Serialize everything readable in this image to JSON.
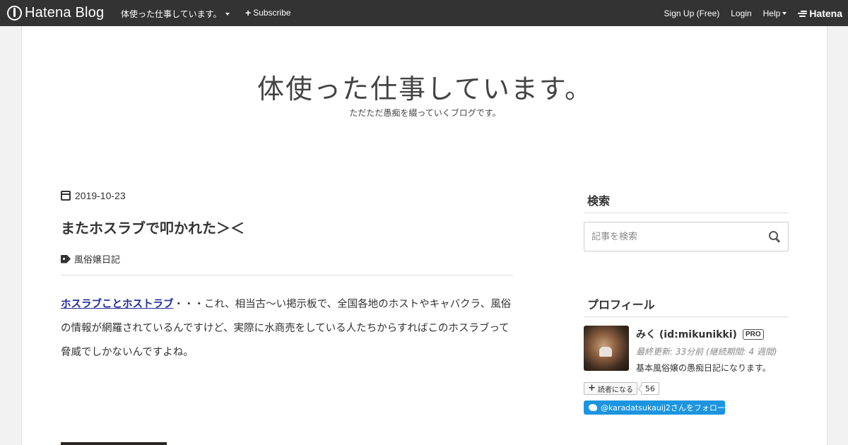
{
  "globalbar": {
    "logo_text": "Hatena Blog",
    "blog_menu_label": "体使った仕事しています。",
    "subscribe_label": "Subscribe",
    "signup_label": "Sign Up (Free)",
    "login_label": "Login",
    "help_label": "Help",
    "hatena_label": "Hatena"
  },
  "header": {
    "title": "体使った仕事しています。",
    "description": "ただただ愚痴を綴っていくブログです。"
  },
  "entry": {
    "date": "2019-10-23",
    "title": "またホスラブで叩かれた＞＜",
    "category": "風俗嬢日記",
    "link_text": "ホスラブことホストラブ",
    "body_text": "・・・これ、相当古～い掲示板で、全国各地のホストやキャバクラ、風俗の情報が網羅されているんですけど、実際に水商売をしている人たちからすればこのホスラブって脅威でしかないんですよね。"
  },
  "sidebar": {
    "search_heading": "検索",
    "search_placeholder": "記事を検索",
    "profile_heading": "プロフィール",
    "profile_name": "みく (id:mikunikki)",
    "pro_badge": "PRO",
    "last_updated": "最終更新: 33分前 (継続期間: 4 週間)",
    "profile_description": "基本風俗嬢の愚痴日記になります。",
    "reader_button_label": "読者になる",
    "reader_count": "56",
    "twitter_follow_label": "@karadatsukauij2さんをフォロー"
  },
  "colors": {
    "globalbar_bg": "#333333",
    "link": "#1f2d9a",
    "twitter": "#1b95e0"
  }
}
